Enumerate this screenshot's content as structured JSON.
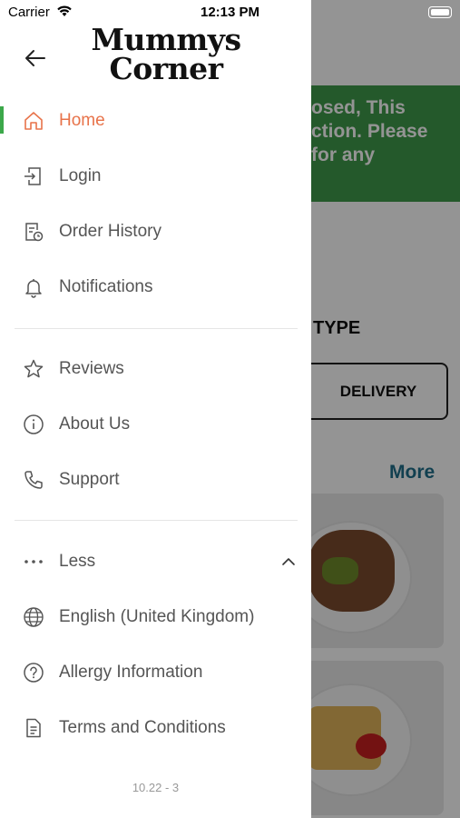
{
  "status_bar": {
    "carrier": "Carrier",
    "time": "12:13 PM"
  },
  "drawer": {
    "logo_line1": "Mummys",
    "logo_line2": "Corner",
    "menu": [
      {
        "label": "Home",
        "icon": "home-icon",
        "active": true
      },
      {
        "label": "Login",
        "icon": "login-icon"
      },
      {
        "label": "Order History",
        "icon": "order-history-icon"
      },
      {
        "label": "Notifications",
        "icon": "bell-icon"
      },
      {
        "label": "Reviews",
        "icon": "star-icon"
      },
      {
        "label": "About Us",
        "icon": "info-icon"
      },
      {
        "label": "Support",
        "icon": "phone-icon"
      },
      {
        "label": "Less",
        "icon": "more-dots-icon"
      },
      {
        "label": "English (United Kingdom)",
        "icon": "globe-icon"
      },
      {
        "label": "Allergy Information",
        "icon": "question-icon"
      },
      {
        "label": "Terms and Conditions",
        "icon": "document-icon"
      }
    ],
    "version": "10.22 - 3"
  },
  "background": {
    "banner_lines": [
      "osed, This",
      "ction. Please",
      "for any"
    ],
    "order_type_label": "TYPE",
    "delivery_label": "DELIVERY",
    "more_label": "More"
  },
  "colors": {
    "accent": "#e8734a",
    "active_bar": "#3ca84a",
    "banner": "#3f9a4a",
    "more": "#1f6f8b"
  }
}
